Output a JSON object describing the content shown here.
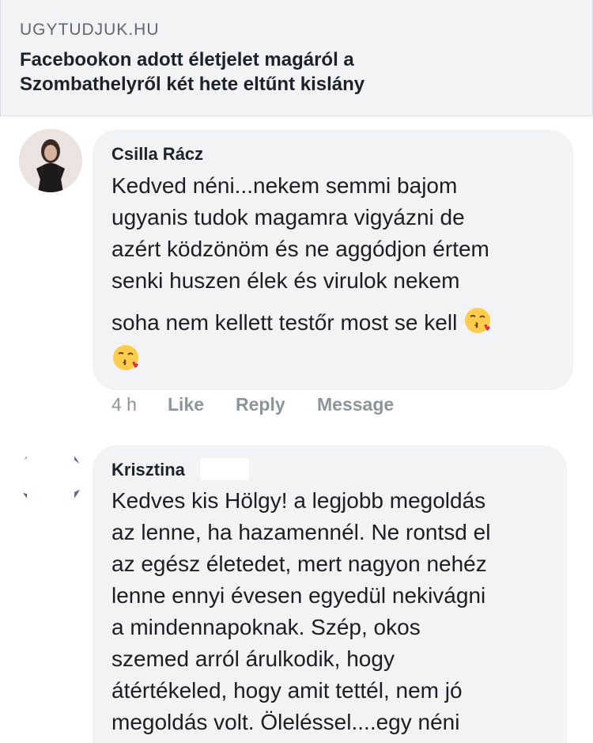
{
  "link_preview": {
    "domain": "UGYTUDJUK.HU",
    "title_line1": "Facebookon adott életjelet magáról a",
    "title_line2": "Szombathelyről két hete eltűnt kislány"
  },
  "comments": [
    {
      "author": "Csilla Rácz",
      "lines": [
        "Kedved néni...nekem semmi bajom",
        "ugyanis tudok magamra vigyázni de",
        "azért ködzönöm és ne aggódjon értem",
        "senki huszen élek és virulok nekem",
        "soha nem kellett testőr most se kell"
      ],
      "emoji": "face-throwing-kiss",
      "time": "4 h",
      "actions": {
        "like": "Like",
        "reply": "Reply",
        "message": "Message"
      }
    },
    {
      "author": "Krisztina",
      "lines": [
        "Kedves kis Hölgy! a legjobb megoldás",
        "az lenne, ha hazamennél. Ne rontsd el",
        "az egész életedet, mert nagyon nehéz",
        "lenne ennyi évesen egyedül nekivágni",
        "a mindennapoknak. Szép, okos",
        "szemed arról árulkodik, hogy",
        "átértékeled, hogy amit tettél, nem jó",
        "megoldás volt. Öleléssel....egy néni"
      ]
    }
  ],
  "colors": {
    "bubble": "#f2f3f5",
    "meta_gray": "#8d949e",
    "text": "#1c1e21",
    "card_bg": "#f2f3f5"
  }
}
